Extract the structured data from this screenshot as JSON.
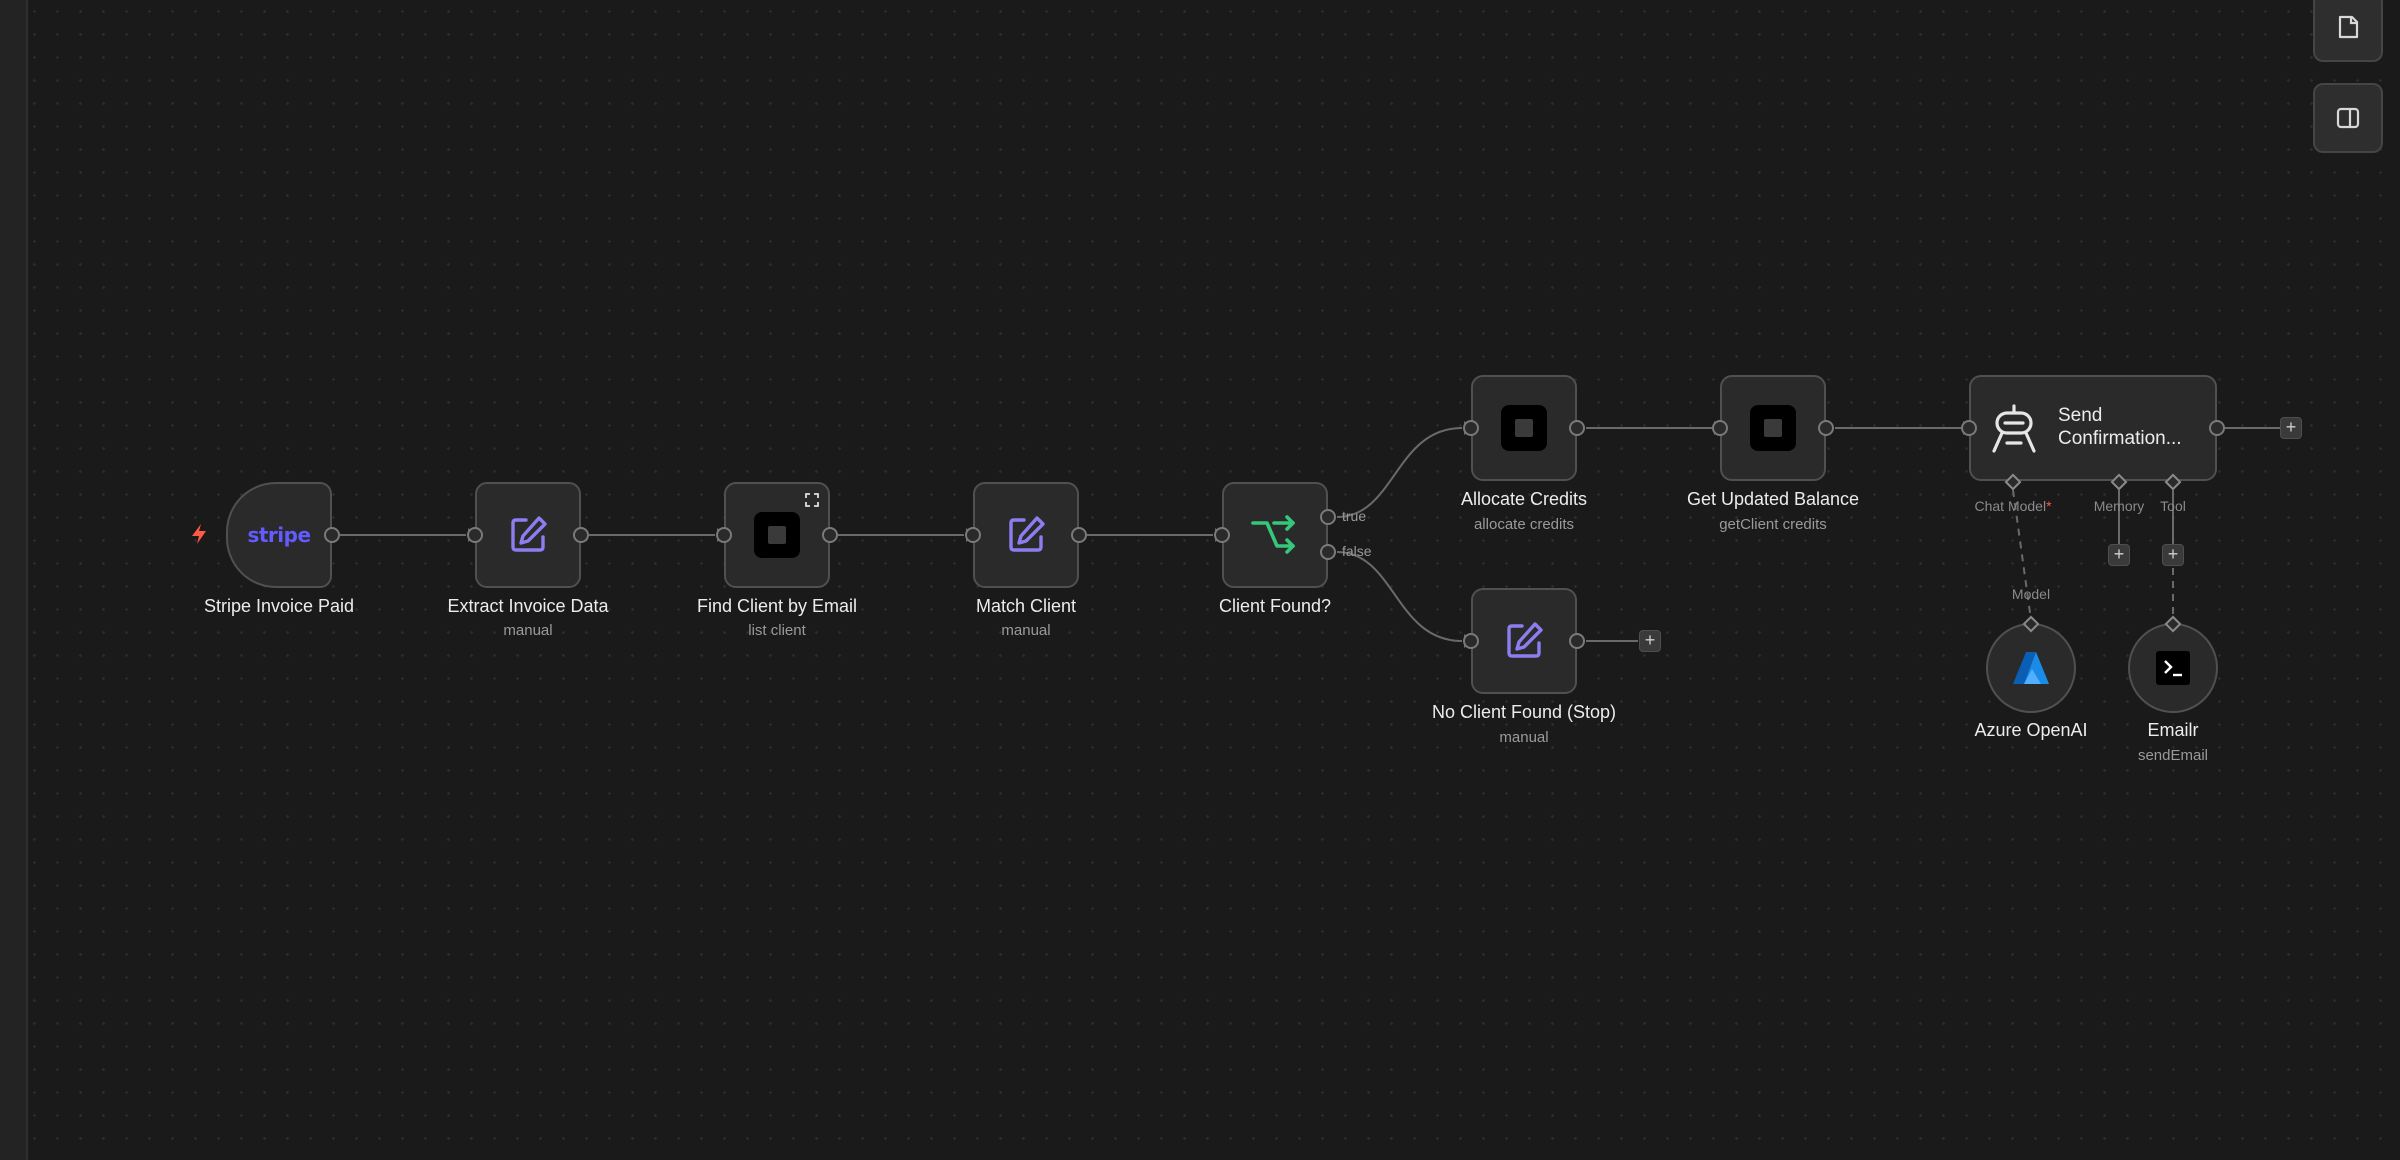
{
  "canvas": {
    "trigger_icon": "lightning-bolt-icon",
    "edge_color": "#6a6a6a",
    "accent_colors": {
      "stripe": "#635bff",
      "edit": "#8c7ef0",
      "if": "#35c77a",
      "trigger": "#ff5a46",
      "azure": "#1a8ce8"
    }
  },
  "toolbar": {
    "sticky_note_icon": "sticky-note-icon",
    "side_panel_icon": "side-panel-icon"
  },
  "nodes": {
    "stripe": {
      "title": "Stripe Invoice Paid",
      "logo_text": "stripe",
      "icon": "stripe-logo"
    },
    "extract": {
      "title": "Extract Invoice Data",
      "subtitle": "manual",
      "icon": "edit-pencil-icon"
    },
    "find_client": {
      "title": "Find Client by Email",
      "subtitle": "list client",
      "icon": "app-square-icon",
      "badge_icon": "expand-icon"
    },
    "match_client": {
      "title": "Match Client",
      "subtitle": "manual",
      "icon": "edit-pencil-icon"
    },
    "client_found": {
      "title": "Client Found?",
      "icon": "if-branch-icon",
      "branch_true": "true",
      "branch_false": "false"
    },
    "allocate": {
      "title": "Allocate Credits",
      "subtitle": "allocate credits",
      "icon": "app-square-icon"
    },
    "get_balance": {
      "title": "Get Updated Balance",
      "subtitle": "getClient credits",
      "icon": "app-square-icon"
    },
    "no_client": {
      "title": "No Client Found (Stop)",
      "subtitle": "manual",
      "icon": "edit-pencil-icon"
    },
    "send_confirmation": {
      "title_line1": "Send",
      "title_line2": "Confirmation...",
      "icon": "robot-agent-icon",
      "port_chat_model": "Chat Model",
      "required_mark": "*",
      "port_memory": "Memory",
      "port_tool": "Tool"
    },
    "azure": {
      "title": "Azure OpenAI",
      "connector_label": "Model",
      "icon": "azure-logo"
    },
    "emailr": {
      "title": "Emailr",
      "subtitle": "sendEmail",
      "icon": "terminal-icon"
    }
  },
  "add_buttons": {
    "label": "+"
  }
}
